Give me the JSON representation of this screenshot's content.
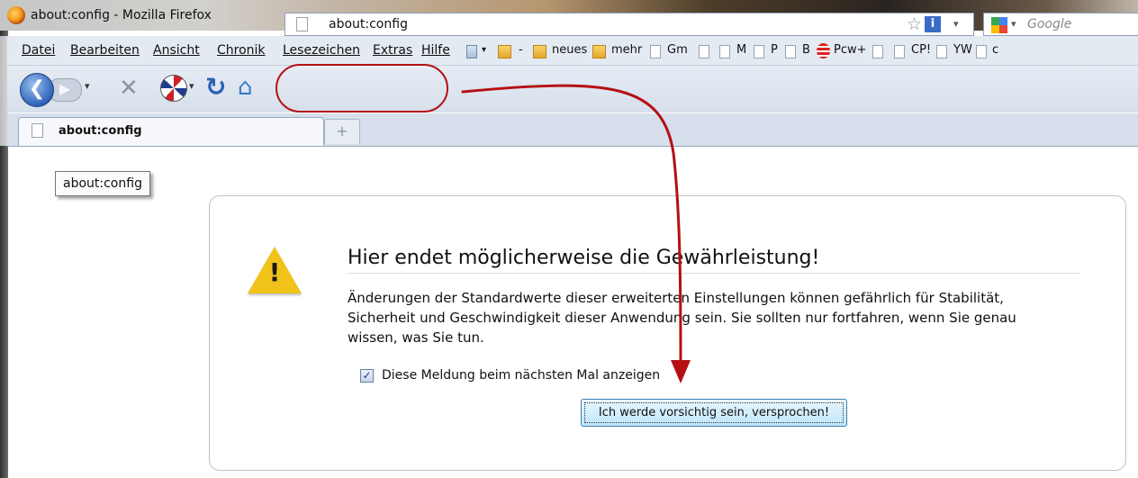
{
  "window": {
    "title": "about:config - Mozilla Firefox"
  },
  "menubar": {
    "menus": [
      "Datei",
      "Bearbeiten",
      "Ansicht",
      "Chronik",
      "Lesezeichen",
      "Extras",
      "Hilfe"
    ],
    "bookmarks": [
      "-",
      "neues",
      "mehr",
      "Gm",
      "M",
      "P",
      "B",
      "Pcw+",
      "CP!",
      "YW",
      "c"
    ]
  },
  "navbar": {
    "url": "about:config",
    "search_placeholder": "Google"
  },
  "tabs": [
    {
      "label": "about:config"
    }
  ],
  "tooltip": {
    "text": "about:config"
  },
  "warning": {
    "title": "Hier endet möglicherweise die Gewährleistung!",
    "text": "Änderungen der Standardwerte dieser erweiterten Einstellungen können gefährlich für Stabilität, Sicherheit und Geschwindigkeit dieser Anwendung sein. Sie sollten nur fortfahren, wenn Sie genau wissen, was Sie tun.",
    "checkbox_label": "Diese Meldung beim nächsten Mal anzeigen",
    "checkbox_checked": true,
    "button_label": "Ich werde vorsichtig sein, versprochen!"
  },
  "colors": {
    "annotation_red": "#b50f14",
    "warning_yellow": "#f0c21a",
    "toolbar_bg": "#e4eaf2"
  }
}
